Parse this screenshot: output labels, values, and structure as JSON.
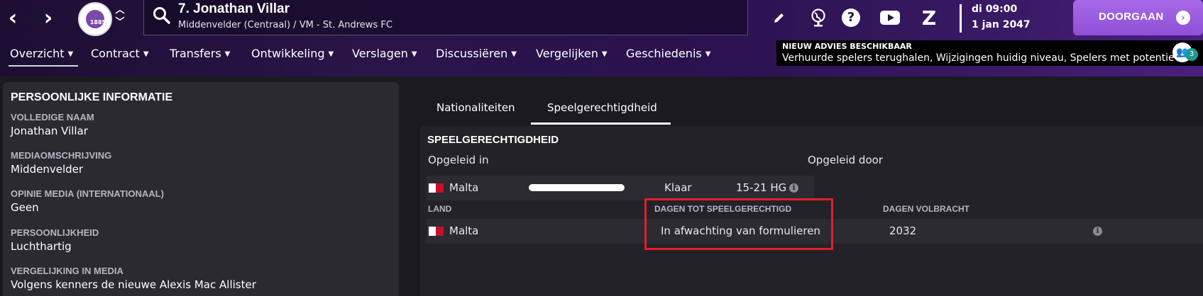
{
  "header": {
    "player_title": "7. Jonathan Villar",
    "player_subtitle": "Middenvelder (Centraal) / VM - St. Andrews FC",
    "club_logo_text": "1885",
    "date_day": "di 09:00",
    "date_date": "1 jan 2047",
    "continue_label": "DOORGAAN",
    "icons": [
      "back-arrow",
      "forward-arrow",
      "search-icon",
      "pencil-icon",
      "globe-icon",
      "help-icon",
      "youtube-icon",
      "z-icon",
      "continue-arrow-icon"
    ]
  },
  "menu": [
    {
      "label": "Overzicht"
    },
    {
      "label": "Contract"
    },
    {
      "label": "Transfers"
    },
    {
      "label": "Ontwikkeling"
    },
    {
      "label": "Verslagen"
    },
    {
      "label": "Discussiëren"
    },
    {
      "label": "Vergelijken"
    },
    {
      "label": "Geschiedenis"
    }
  ],
  "advice": {
    "title": "NIEUW ADVIES BESCHIKBAAR",
    "text": "Verhuurde spelers terughalen, Wijzigingen huidig niveau, Spelers met potentie",
    "count": "3"
  },
  "personal": {
    "title": "PERSOONLIJKE INFORMATIE",
    "fields": [
      {
        "label": "VOLLEDIGE NAAM",
        "value": "Jonathan Villar"
      },
      {
        "label": "MEDIAOMSCHRIJVING",
        "value": "Middenvelder"
      },
      {
        "label": "OPINIE MEDIA (INTERNATIONAAL)",
        "value": "Geen"
      },
      {
        "label": "PERSOONLIJKHEID",
        "value": "Luchthartig"
      },
      {
        "label": "VERGELIJKING IN MEDIA",
        "value": "Volgens kenners de nieuwe Alexis Mac Allister"
      }
    ]
  },
  "tabs": [
    {
      "label": "Nationaliteiten",
      "active": false
    },
    {
      "label": "Speelgerechtigdheid",
      "active": true
    }
  ],
  "eligibility": {
    "title": "SPEELGERECHTIGDHEID",
    "trained_in_label": "Opgeleid in",
    "trained_by_label": "Opgeleid door",
    "trained_row": {
      "country": "Malta",
      "progress": 1.0,
      "status": "Klaar",
      "age_range": "15-21 HG"
    },
    "col_land": "LAND",
    "col_days_to": "DAGEN TOT SPEELGERECHTIGD",
    "col_days_done": "DAGEN VOLBRACHT",
    "row": {
      "country": "Malta",
      "days_to": "In afwachting van formulieren",
      "days_done": "2032"
    }
  },
  "colors": {
    "accent": "#8f4fd8",
    "highlight": "#e0202a",
    "malta_red": "#c8102e"
  }
}
